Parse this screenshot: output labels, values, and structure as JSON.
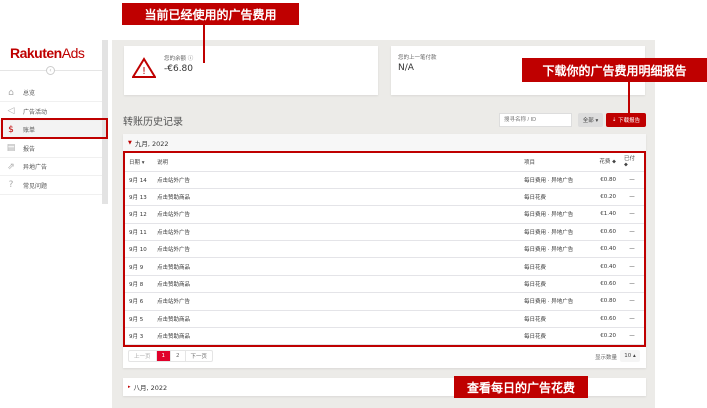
{
  "logo": {
    "brand": "Rakuten",
    "product": "Ads"
  },
  "sidebar": {
    "items": [
      {
        "label": "总览",
        "icon": "home-icon"
      },
      {
        "label": "广告活动",
        "icon": "megaphone-icon"
      },
      {
        "label": "账单",
        "icon": "dollar-icon",
        "active": true
      },
      {
        "label": "报告",
        "icon": "document-icon"
      },
      {
        "label": "异地广告",
        "icon": "external-link-icon"
      },
      {
        "label": "常见问题",
        "icon": "question-icon"
      }
    ]
  },
  "balance": {
    "label": "您的余额 ⓘ",
    "value": "-€6.80",
    "icon": "warning-icon"
  },
  "last_payment": {
    "label": "您的上一笔付款",
    "value": "N/A"
  },
  "history": {
    "title": "转账历史记录",
    "search_placeholder": "搜寻名称 / ID",
    "filter": "全部 ▾",
    "download": "下载报告",
    "month": "九月, 2022",
    "columns": [
      "日期 ▾",
      "说明",
      "项目",
      "花费 ⬥",
      "已付 ⬥"
    ],
    "rows": [
      {
        "date": "9月 14",
        "desc": "点击站外广告",
        "item": "每日费用 · 异地广告",
        "spend": "€0.80",
        "paid": "—"
      },
      {
        "date": "9月 13",
        "desc": "点击赞助商品",
        "item": "每日花费",
        "spend": "€0.20",
        "paid": "—"
      },
      {
        "date": "9月 12",
        "desc": "点击站外广告",
        "item": "每日费用 · 异地广告",
        "spend": "€1.40",
        "paid": "—"
      },
      {
        "date": "9月 11",
        "desc": "点击站外广告",
        "item": "每日费用 · 异地广告",
        "spend": "€0.60",
        "paid": "—"
      },
      {
        "date": "9月 10",
        "desc": "点击站外广告",
        "item": "每日费用 · 异地广告",
        "spend": "€0.40",
        "paid": "—"
      },
      {
        "date": "9月 9",
        "desc": "点击赞助商品",
        "item": "每日花费",
        "spend": "€0.40",
        "paid": "—"
      },
      {
        "date": "9月 8",
        "desc": "点击赞助商品",
        "item": "每日花费",
        "spend": "€0.60",
        "paid": "—"
      },
      {
        "date": "9月 6",
        "desc": "点击站外广告",
        "item": "每日费用 · 异地广告",
        "spend": "€0.80",
        "paid": "—"
      },
      {
        "date": "9月 5",
        "desc": "点击赞助商品",
        "item": "每日花费",
        "spend": "€0.60",
        "paid": "—"
      },
      {
        "date": "9月 3",
        "desc": "点击赞助商品",
        "item": "每日花费",
        "spend": "€0.20",
        "paid": "—"
      }
    ],
    "pagination": {
      "prev": "上一页",
      "pages": [
        "1",
        "2"
      ],
      "current": "1",
      "next": "下一页"
    },
    "page_size_label": "显示数量",
    "page_size": "10 ▴",
    "next_month": "八月, 2022"
  },
  "callouts": {
    "spent": "当前已经使用的广告费用",
    "download": "下载你的广告费用明细报告",
    "daily": "查看每日的广告花费"
  },
  "colors": {
    "accent": "#bf0000",
    "page_active": "#e0002a"
  }
}
